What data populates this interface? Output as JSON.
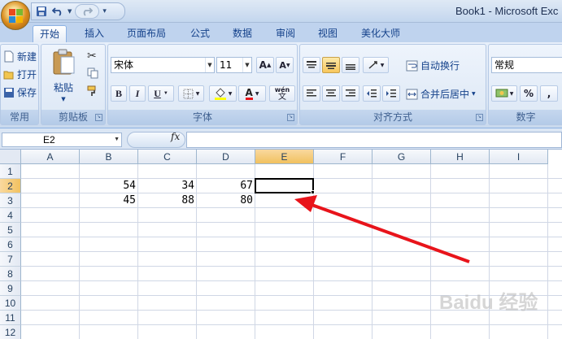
{
  "app": {
    "title": "Book1 - Microsoft Exc",
    "qat_more": "▾"
  },
  "tabs": [
    {
      "label": "开始",
      "active": true
    },
    {
      "label": "插入"
    },
    {
      "label": "页面布局"
    },
    {
      "label": "公式"
    },
    {
      "label": "数据"
    },
    {
      "label": "审阅"
    },
    {
      "label": "视图"
    },
    {
      "label": "美化大师"
    }
  ],
  "ribbon": {
    "common": {
      "new": "新建",
      "open": "打开",
      "save": "保存",
      "label": "常用"
    },
    "clipboard": {
      "paste": "粘贴",
      "label": "剪贴板"
    },
    "font": {
      "name": "宋体",
      "size": "11",
      "bold": "B",
      "italic": "I",
      "underline": "U",
      "wen": "wén",
      "wen_char": "文",
      "label": "字体"
    },
    "alignment": {
      "wrap": "自动换行",
      "merge": "合并后居中",
      "label": "对齐方式"
    },
    "number": {
      "format": "常规",
      "percent": "%",
      "comma": ",",
      "label": "数字"
    }
  },
  "formula_bar": {
    "name_box": "E2",
    "fx": "fx",
    "value": ""
  },
  "sheet": {
    "columns": [
      "A",
      "B",
      "C",
      "D",
      "E",
      "F",
      "G",
      "H",
      "I"
    ],
    "selected_column": "E",
    "rows": [
      "1",
      "2",
      "3",
      "4",
      "5",
      "6",
      "7",
      "8",
      "9",
      "10",
      "11",
      "12"
    ],
    "selected_row": "2",
    "cells": {
      "B2": "54",
      "C2": "34",
      "D2": "67",
      "B3": "45",
      "C3": "88",
      "D3": "80"
    },
    "active_cell": "E2"
  },
  "colors": {
    "accent": "#f1c15f",
    "arrow": "#e8141b"
  },
  "watermark": "Baidu 经验"
}
